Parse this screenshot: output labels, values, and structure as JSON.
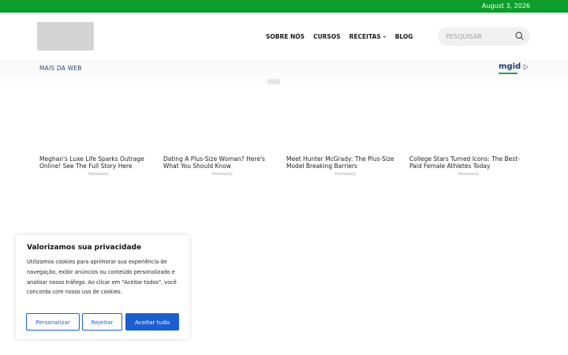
{
  "topbar": {
    "date": "August 3, 2026",
    "color": "#0e9d2a"
  },
  "header": {
    "nav": [
      {
        "label": "SOBRE NÓS"
      },
      {
        "label": "CURSOS"
      },
      {
        "label": "RECEITAS",
        "has_caret": true
      },
      {
        "label": "BLOG"
      }
    ],
    "search": {
      "placeholder": "PESQUISAR"
    }
  },
  "ads": {
    "section_label": "MAIS DA WEB",
    "brand": "mgid",
    "cards": [
      {
        "title": "Meghan's Luxe Life Sparks Outrage Online! See The Full Story Here",
        "source": "Herbeauty"
      },
      {
        "title": "Dating A Plus-Size Woman? Here's What You Should Know",
        "source": "Herbeauty"
      },
      {
        "title": "Meet Hunter McGrady: The Plus-Size Model Breaking Barriers",
        "source": "Herbeauty"
      },
      {
        "title": "College Stars Turned Icons: The Best-Paid Female Athletes Today",
        "source": "Herbeauty"
      }
    ]
  },
  "cookie": {
    "title": "Valorizamos sua privacidade",
    "body": "Utilizamos cookies para aprimorar sua experiência de navegação, exibir anúncios ou conteúdo personalizado e analisar nosso tráfego. Ao clicar em \"Aceitar todos\", você concorda com nosso uso de cookies.",
    "buttons": {
      "customize": "Personalizar",
      "reject": "Rejeitar",
      "accept": "Aceitar tudo"
    },
    "accent": "#1e5fd0"
  }
}
